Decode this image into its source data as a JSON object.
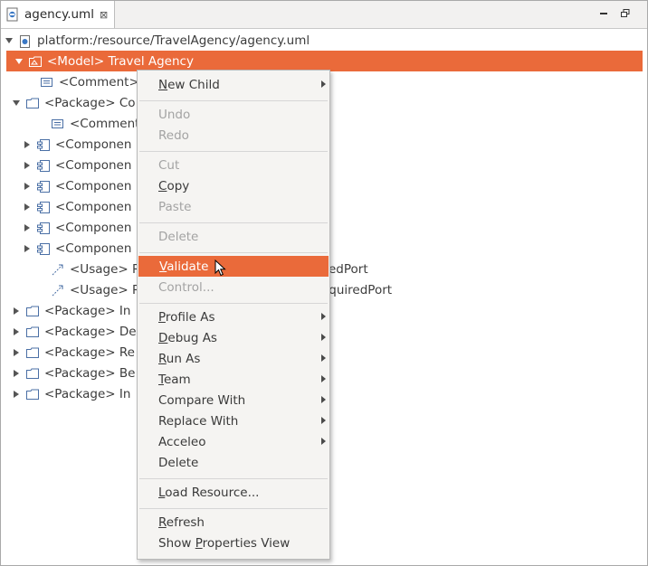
{
  "editor": {
    "tab_title": "agency.uml",
    "tab_close": "⊠"
  },
  "tree": {
    "root_label": "platform:/resource/TravelAgency/agency.uml",
    "model_label": "<Model> Travel Agency",
    "rows": [
      {
        "label": "<Comment> T",
        "icon": "comment-icon"
      },
      {
        "label": "<Package> Co",
        "icon": "package-icon"
      },
      {
        "label": "<Comment",
        "icon": "comment-icon"
      },
      {
        "label": "<Componen",
        "icon": "component-icon"
      },
      {
        "label": "<Componen",
        "icon": "component-icon"
      },
      {
        "label": "<Componen",
        "icon": "component-icon"
      },
      {
        "label": "<Componen",
        "icon": "component-icon"
      },
      {
        "label": "<Componen",
        "icon": "component-icon"
      },
      {
        "label": "<Componen",
        "icon": "component-icon"
      },
      {
        "label": "<Usage> Re",
        "icon": "usage-icon",
        "trail": "edPort"
      },
      {
        "label": "<Usage> Re",
        "icon": "usage-icon",
        "trail": "equiredPort"
      },
      {
        "label": "<Package> In",
        "icon": "package-icon"
      },
      {
        "label": "<Package> De",
        "icon": "package-icon"
      },
      {
        "label": "<Package> Re",
        "icon": "package-icon"
      },
      {
        "label": "<Package> Be",
        "icon": "package-icon"
      },
      {
        "label": "<Package> In",
        "icon": "package-icon"
      }
    ]
  },
  "context_menu": {
    "items": [
      {
        "label": "New Child",
        "enabled": true,
        "submenu": true
      },
      {
        "label": "Undo",
        "enabled": false
      },
      {
        "label": "Redo",
        "enabled": false
      },
      {
        "label": "Cut",
        "enabled": false
      },
      {
        "label": "Copy",
        "enabled": true
      },
      {
        "label": "Paste",
        "enabled": false
      },
      {
        "label": "Delete",
        "enabled": false
      },
      {
        "label": "Validate",
        "enabled": true,
        "active": true
      },
      {
        "label": "Control...",
        "enabled": false
      },
      {
        "label": "Profile As",
        "enabled": true,
        "submenu": true
      },
      {
        "label": "Debug As",
        "enabled": true,
        "submenu": true
      },
      {
        "label": "Run As",
        "enabled": true,
        "submenu": true
      },
      {
        "label": "Team",
        "enabled": true,
        "submenu": true
      },
      {
        "label": "Compare With",
        "enabled": true,
        "submenu": true
      },
      {
        "label": "Replace With",
        "enabled": true,
        "submenu": true
      },
      {
        "label": "Acceleo",
        "enabled": true,
        "submenu": true
      },
      {
        "label": "Delete",
        "enabled": true
      },
      {
        "label": "Load Resource...",
        "enabled": true
      },
      {
        "label": "Refresh",
        "enabled": true
      },
      {
        "label": "Show Properties View",
        "enabled": true
      }
    ]
  },
  "colors": {
    "selection": "#ea6a3a",
    "menu_bg": "#f5f4f2",
    "disabled_text": "#a3a3a3"
  }
}
